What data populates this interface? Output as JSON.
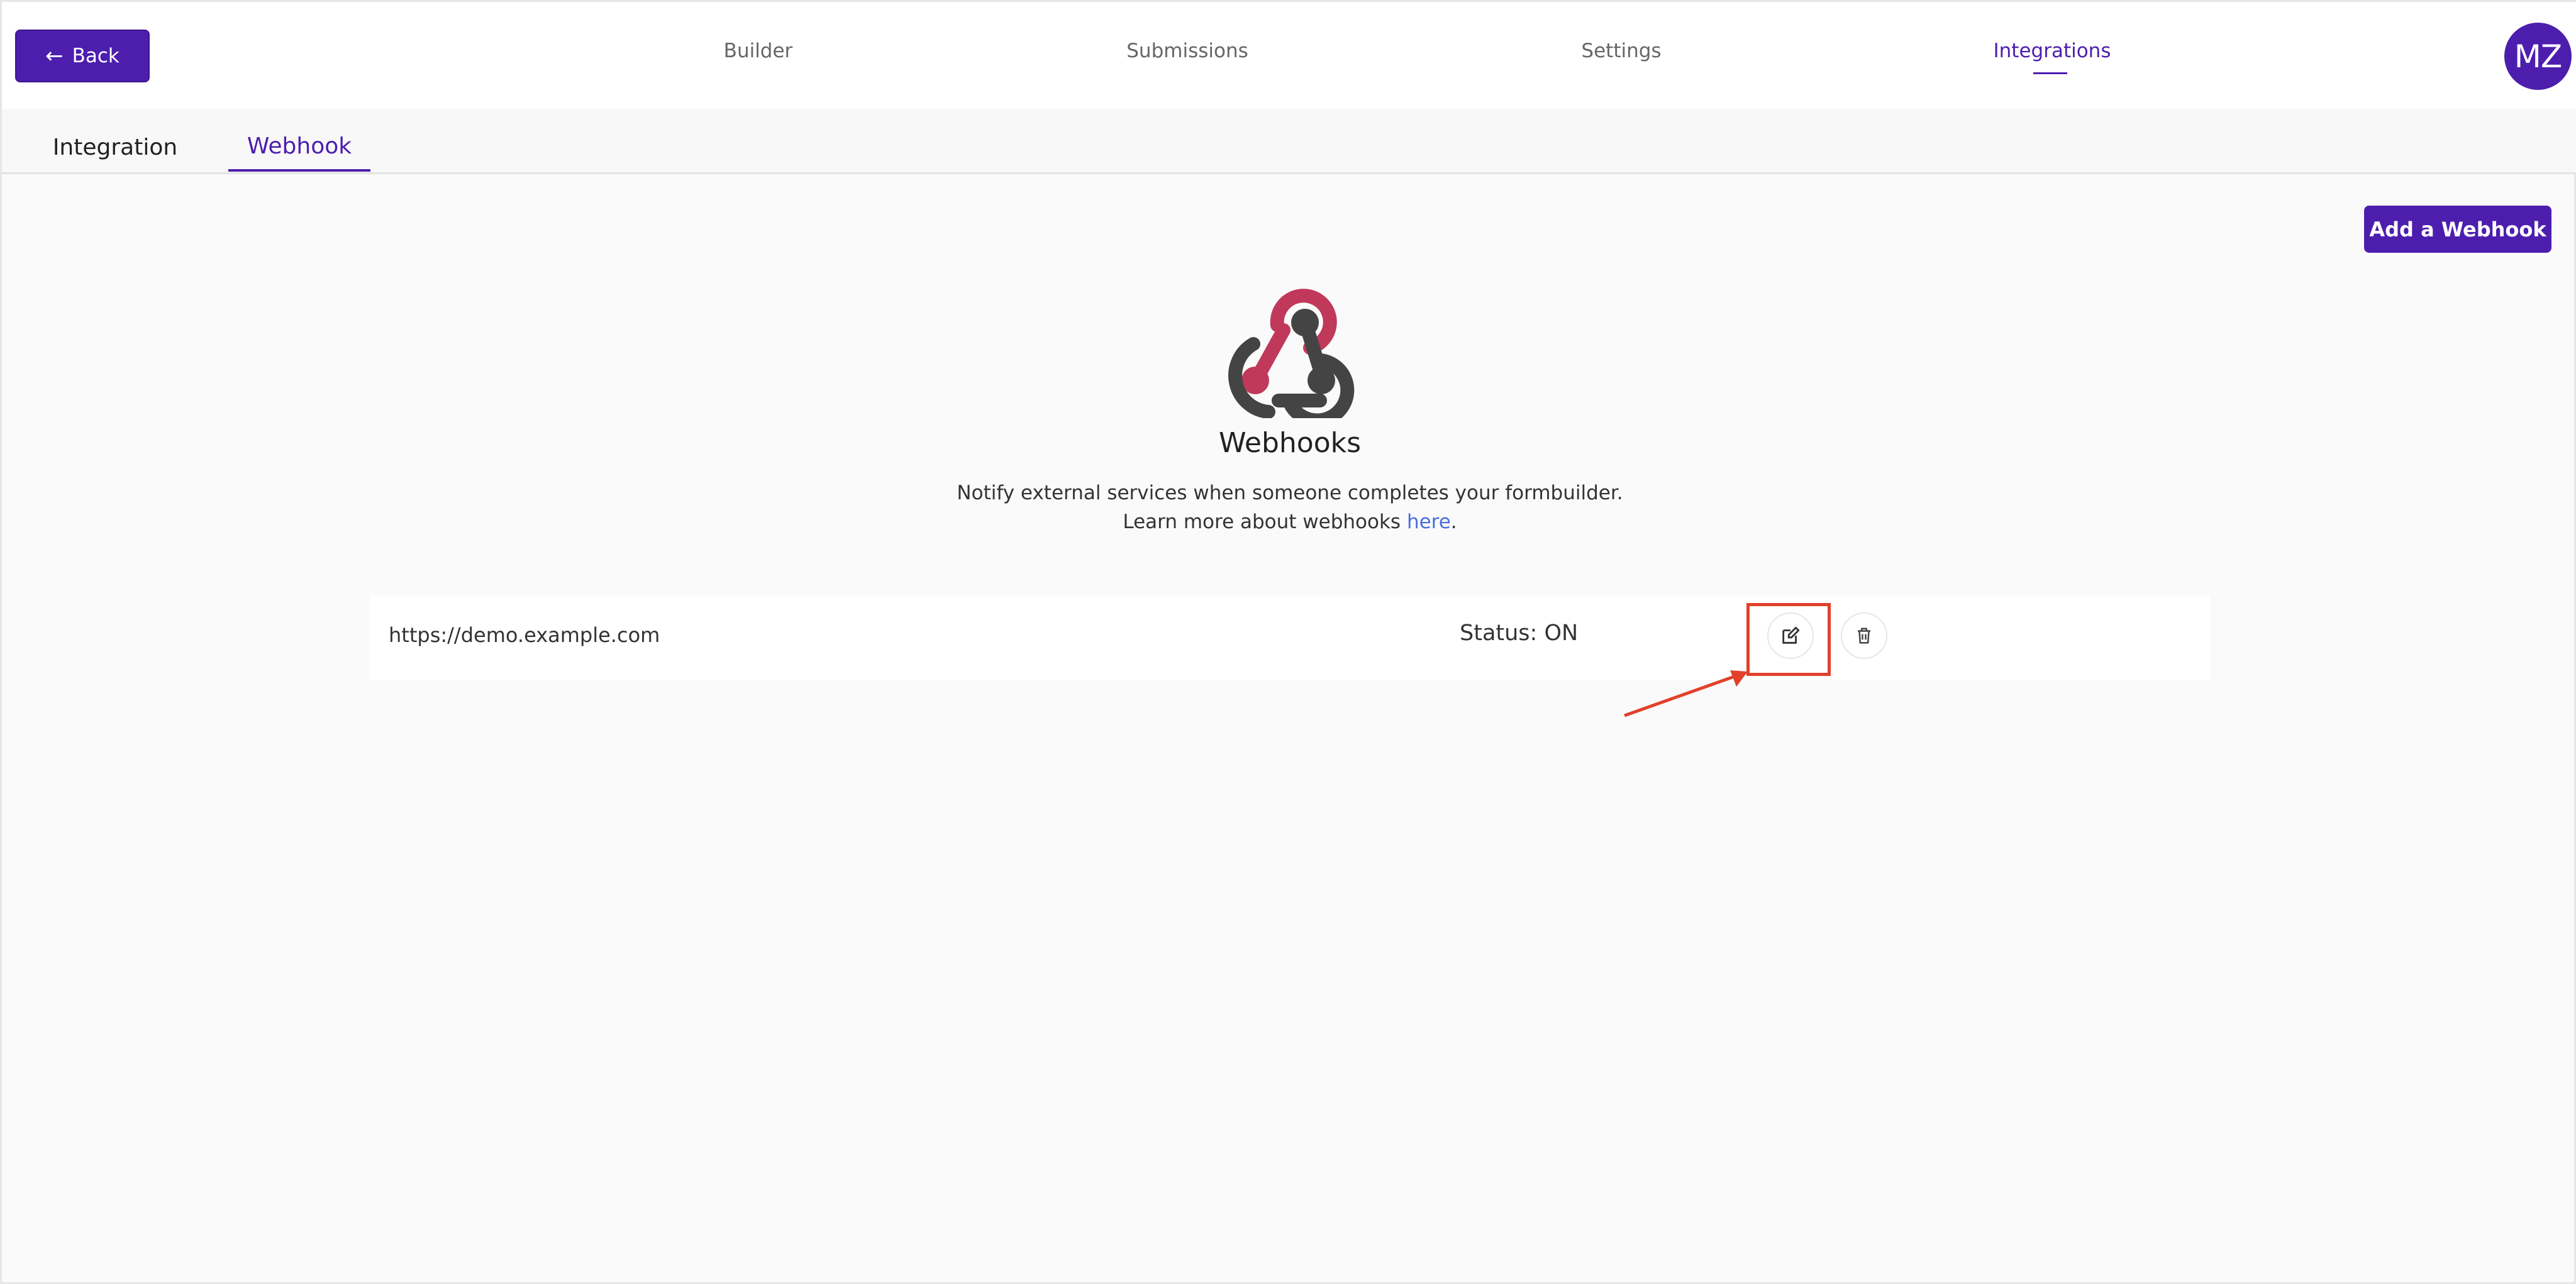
{
  "topbar": {
    "back_label": "Back",
    "nav": [
      {
        "label": "Builder",
        "active": false
      },
      {
        "label": "Submissions",
        "active": false
      },
      {
        "label": "Settings",
        "active": false
      },
      {
        "label": "Integrations",
        "active": true
      }
    ],
    "avatar_initials": "MZ"
  },
  "subtabs": [
    {
      "label": "Integration",
      "active": false
    },
    {
      "label": "Webhook",
      "active": true
    }
  ],
  "actions": {
    "add_webhook_label": "Add a Webhook"
  },
  "content": {
    "heading": "Webhooks",
    "description_line1": "Notify external services when someone completes your formbuilder.",
    "description_line2_prefix": "Learn more about webhooks ",
    "description_link": "here",
    "description_line2_suffix": "."
  },
  "webhooks": [
    {
      "url": "https://demo.example.com",
      "status": "Status: ON"
    }
  ],
  "icons": {
    "back": "arrow-left-icon",
    "logo": "webhook-logo",
    "edit": "edit-icon",
    "delete": "trash-icon"
  },
  "colors": {
    "accent": "#4d1eae",
    "link": "#4a6fe0",
    "annotation": "#e2402a",
    "logo_pink": "#c0395a",
    "logo_dark": "#444444"
  }
}
